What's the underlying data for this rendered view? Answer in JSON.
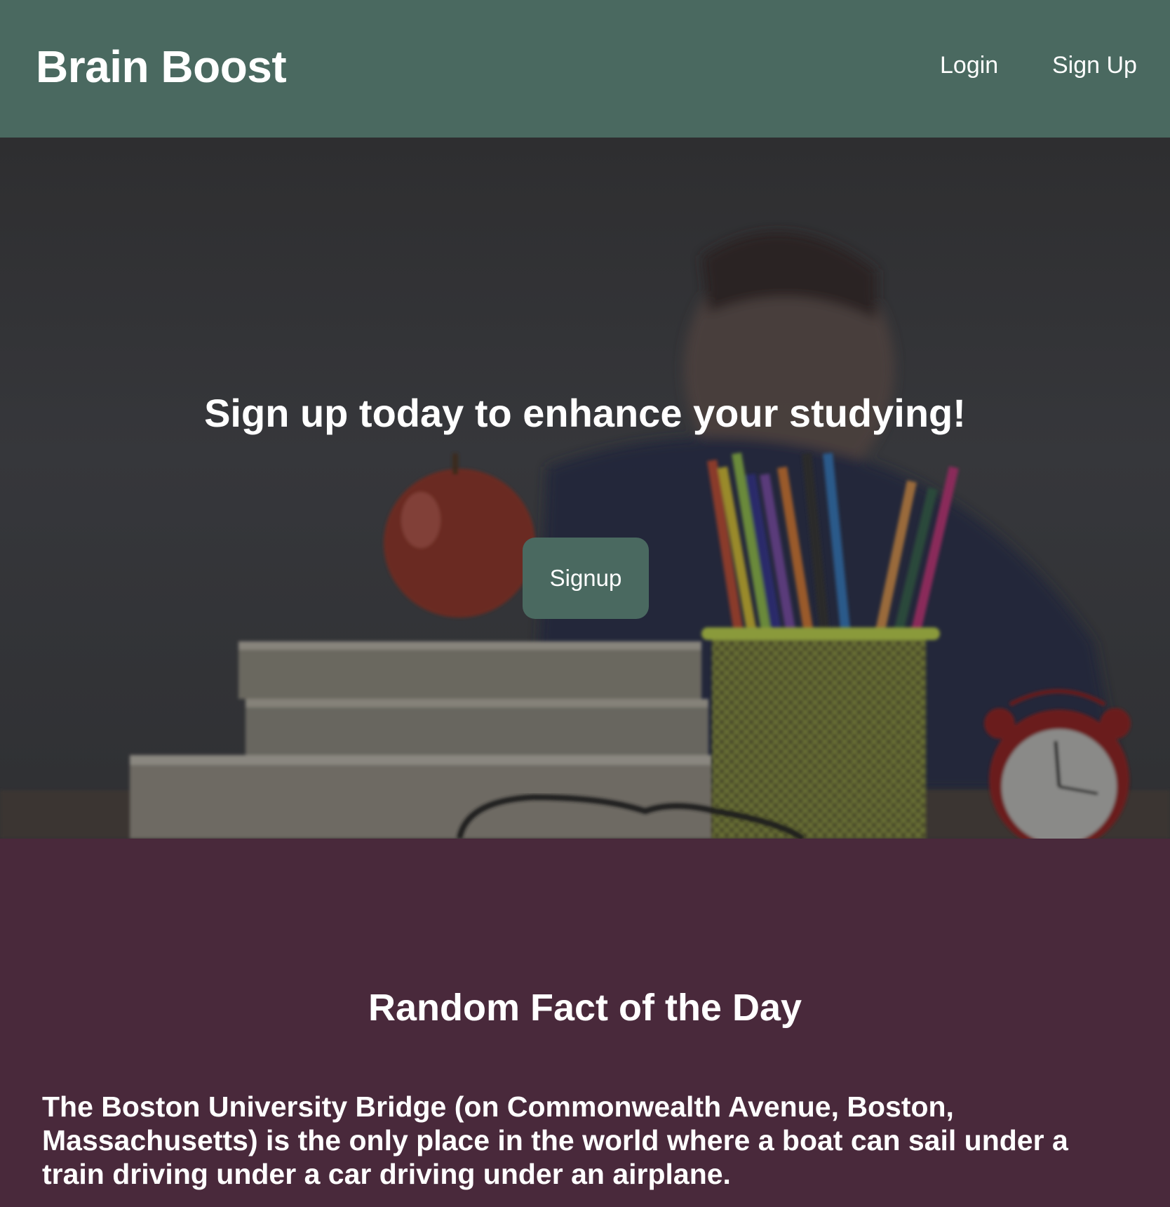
{
  "header": {
    "brand": "Brain Boost",
    "nav": {
      "login_label": "Login",
      "signup_label": "Sign Up"
    }
  },
  "hero": {
    "title": "Sign up today to enhance your studying!",
    "button_label": "Signup",
    "background_image": "blurred-student-with-books-apple-pencils-clock"
  },
  "fact": {
    "title": "Random Fact of the Day",
    "text": "The Boston University Bridge (on Commonwealth Avenue, Boston, Massachusetts) is the only place in the world where a boat can sail under a train driving under a car driving under an airplane."
  },
  "colors": {
    "header_bg": "#4a6960",
    "button_bg": "#4a6960",
    "fact_bg": "#49293b",
    "text": "#ffffff"
  }
}
